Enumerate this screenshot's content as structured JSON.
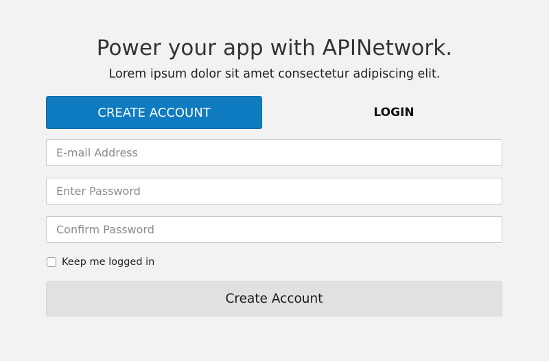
{
  "header": {
    "title": "Power your app with APINetwork.",
    "subtitle": "Lorem ipsum dolor sit amet consectetur adipiscing elit."
  },
  "tabs": [
    {
      "label": "CREATE ACCOUNT",
      "active": true
    },
    {
      "label": "LOGIN",
      "active": false
    }
  ],
  "form": {
    "email": {
      "placeholder": "E-mail Address",
      "value": ""
    },
    "password": {
      "placeholder": "Enter Password",
      "value": ""
    },
    "confirm_password": {
      "placeholder": "Confirm Password",
      "value": ""
    },
    "remember": {
      "label": "Keep me logged in",
      "checked": false
    },
    "submit_label": "Create Account"
  },
  "colors": {
    "background": "#f2f2f2",
    "accent": "#0f7bc0",
    "submit_bg": "#e1e1e1"
  }
}
